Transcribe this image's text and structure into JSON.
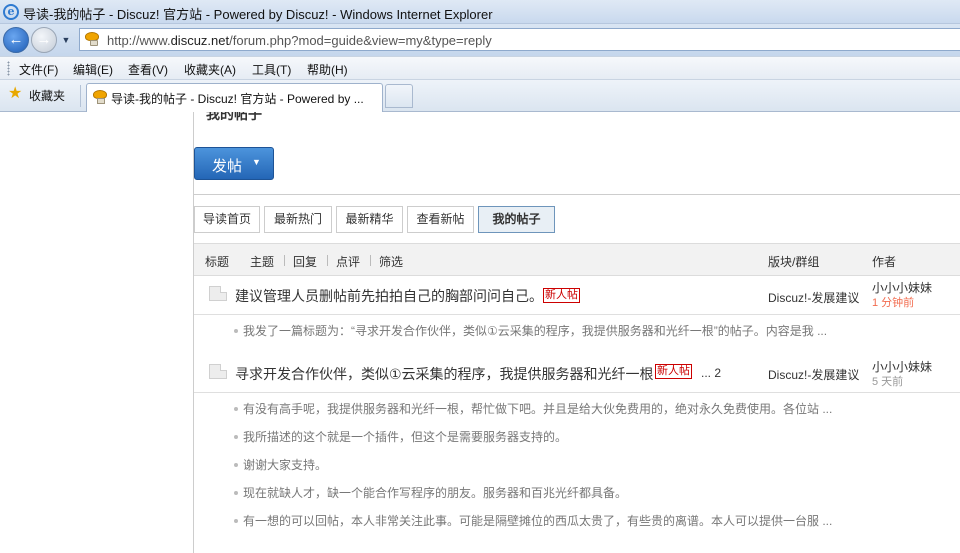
{
  "window": {
    "title": "导读-我的帖子 - Discuz! 官方站 - Powered by Discuz! - Windows Internet Explorer",
    "url_prefix": "http://www.",
    "url_domain": "discuz.net",
    "url_suffix": "/forum.php?mod=guide&view=my&type=reply"
  },
  "menu": {
    "items": [
      "文件(F)",
      "编辑(E)",
      "查看(V)",
      "收藏夹(A)",
      "工具(T)",
      "帮助(H)"
    ]
  },
  "favorites": {
    "label": "收藏夹",
    "tab_title": "导读-我的帖子 - Discuz! 官方站 - Powered by ..."
  },
  "page": {
    "title": "我的帖子",
    "post_button": "发帖",
    "guide_tabs": [
      "导读首页",
      "最新热门",
      "最新精华",
      "查看新帖",
      "我的帖子"
    ],
    "table_header": {
      "title": "标题",
      "filters": [
        "主题",
        "回复",
        "点评",
        "筛选"
      ],
      "forum": "版块/群组",
      "author": "作者"
    },
    "threads": [
      {
        "title": "建议管理人员删帖前先拍拍自己的胸部问问自己。",
        "badge": "新人帖",
        "pager": "",
        "forum": "Discuz!-发展建议",
        "author": "小小小妹妹",
        "time": "1 分钟前",
        "replies": [
          "我发了一篇标题为：“寻求开发合作伙伴，类似①云采集的程序，我提供服务器和光纤一根”的帖子。内容是我 ..."
        ]
      },
      {
        "title": "寻求开发合作伙伴，类似①云采集的程序，我提供服务器和光纤一根",
        "badge": "新人帖",
        "pager": "... 2",
        "forum": "Discuz!-发展建议",
        "author": "小小小妹妹",
        "time": "5 天前",
        "replies": [
          "有没有高手呢，我提供服务器和光纤一根，帮忙做下吧。并且是给大伙免费用的，绝对永久免费使用。各位站 ...",
          "我所描述的这个就是一个插件，但这个是需要服务器支持的。",
          "谢谢大家支持。",
          "现在就缺人才，缺一个能合作写程序的朋友。服务器和百兆光纤都具备。",
          "有一想的可以回帖，本人非常关注此事。可能是隔壁摊位的西瓜太贵了，有些贵的离谱。本人可以提供一台服 ..."
        ]
      }
    ]
  }
}
